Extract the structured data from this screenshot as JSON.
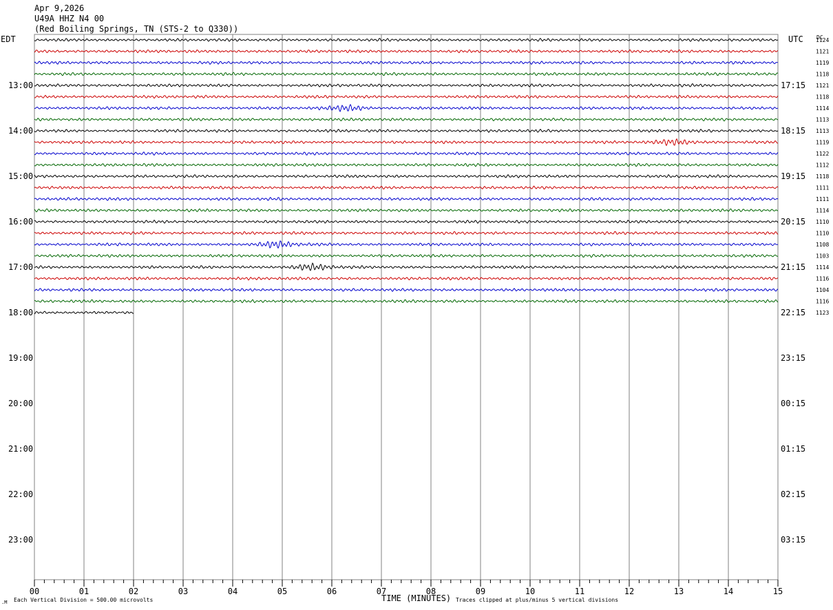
{
  "header": {
    "date": "Apr 9,2026",
    "station": "U49A HHZ N4 00",
    "location": "(Red Boiling Springs, TN (STS-2 to Q330))"
  },
  "left_timezone": "EDT",
  "right_timezone": "UTC",
  "dc_label": "DC",
  "left_hour_labels": [
    "13:00",
    "14:00",
    "15:00",
    "16:00",
    "17:00",
    "18:00",
    "19:00",
    "20:00",
    "21:00",
    "22:00",
    "23:00"
  ],
  "right_hour_labels": [
    "17:15",
    "18:15",
    "19:15",
    "20:15",
    "21:15",
    "22:15",
    "23:15",
    "00:15",
    "01:15",
    "02:15",
    "03:15"
  ],
  "dc_offsets": [
    "1124",
    "1121",
    "1119",
    "1118",
    "1121",
    "1118",
    "1114",
    "1113",
    "1113",
    "1119",
    "1122",
    "1112",
    "1118",
    "1111",
    "1111",
    "1114",
    "1110",
    "1110",
    "1108",
    "1103",
    "1114",
    "1116",
    "1104",
    "1116",
    "1123"
  ],
  "x_tick_labels": [
    "00",
    "01",
    "02",
    "03",
    "04",
    "05",
    "06",
    "07",
    "08",
    "09",
    "10",
    "11",
    "12",
    "13",
    "14",
    "15"
  ],
  "footer": {
    "xlabel": "TIME (MINUTES)",
    "scale_note": "Each Vertical Division =  500.00 microvolts",
    "clip_note": "Traces clipped at plus/minus 5 vertical divisions"
  },
  "colors": {
    "trace_cycle": [
      "#000000",
      "#cc0000",
      "#0000cc",
      "#006600"
    ],
    "grid": "#808080"
  },
  "chart_data": {
    "type": "line",
    "title": "",
    "xlabel": "TIME (MINUTES)",
    "ylabel": "",
    "xlim": [
      0,
      15
    ],
    "minutes_per_line": 15,
    "lines_total_displayed": 25,
    "full_lines": 24,
    "partial_last_line_minutes": 2,
    "first_line_start_edt": "12:00",
    "units": "microvolts",
    "vertical_division_microvolts": 500,
    "clip_divisions": 5,
    "events": [
      {
        "line": 6,
        "minute": 6.3,
        "series_color": "blue"
      },
      {
        "line": 9,
        "minute": 12.9,
        "series_color": "red"
      },
      {
        "line": 18,
        "minute": 4.9,
        "series_color": "blue"
      },
      {
        "line": 20,
        "minute": 5.6,
        "series_color": "black"
      }
    ]
  }
}
